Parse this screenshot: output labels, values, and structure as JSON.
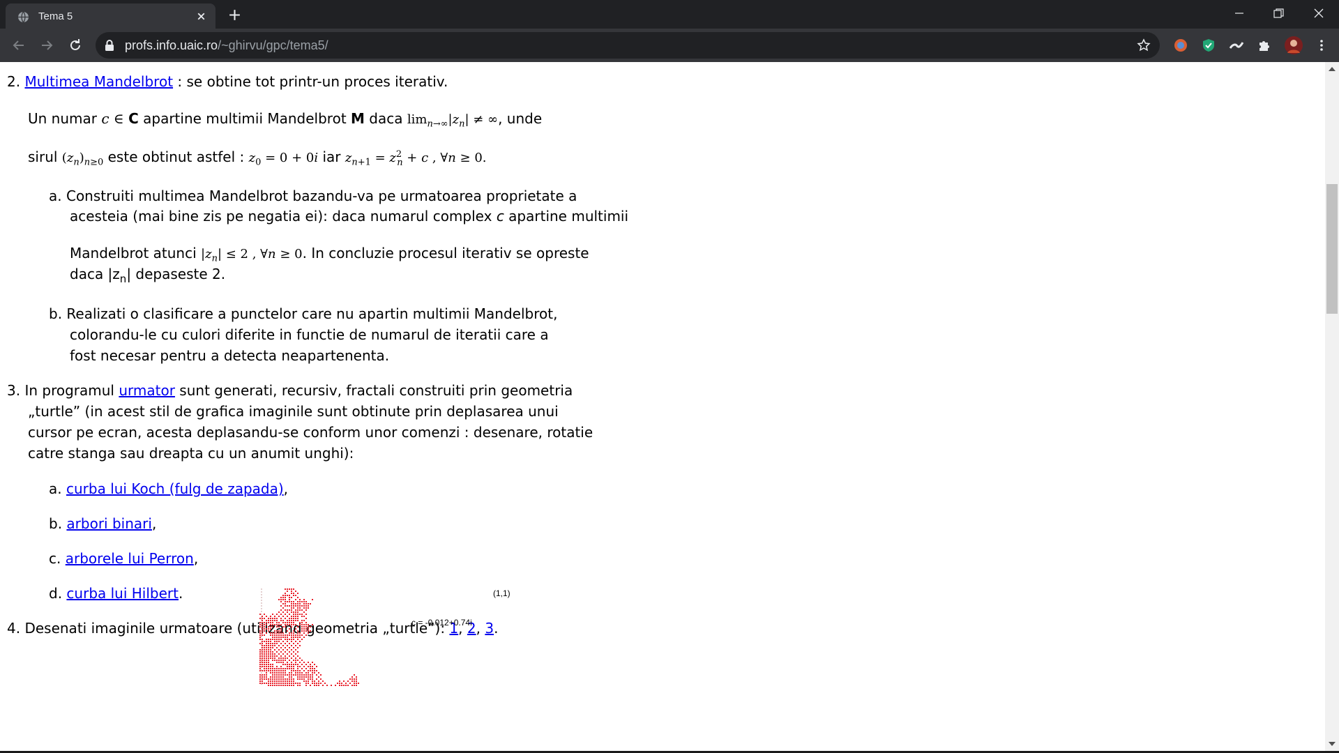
{
  "browser": {
    "tab_title": "Tema 5",
    "url_host": "profs.info.uaic.ro",
    "url_path": "/~ghirvu/gpc/tema5/"
  },
  "page": {
    "item2": {
      "number": "2.",
      "link": "Multimea Mandelbrot",
      "rest": " : se obtine tot printr-un proces iterativ.",
      "p1_a": "Un numar ",
      "p1_b": " apartine multimii Mandelbrot ",
      "p1_M": "M",
      "p1_c": " daca ",
      "p1_d": ", unde",
      "p2_a": "sirul ",
      "p2_b": " este obtinut astfel : ",
      "p2_c": " iar ",
      "sub_a": {
        "letter": "a.",
        "l1": "Construiti multimea Mandelbrot bazandu-va pe urmatoarea proprietate a",
        "l2a": "acesteia (mai bine zis pe negatia ei): daca numarul complex ",
        "l2c": "c",
        "l2b": " apartine multimii",
        "l3a": "Mandelbrot atunci ",
        "l3b": ". In concluzie procesul iterativ se opreste",
        "l4a": "daca |z",
        "l4sub": "n",
        "l4b": "| depaseste 2."
      },
      "sub_b": {
        "letter": "b.",
        "l1": "Realizati o clasificare a punctelor care nu apartin multimii Mandelbrot,",
        "l2": "colorandu-le cu culori diferite in functie de numarul de iteratii care a",
        "l3": "fost necesar pentru a detecta neapartenenta."
      }
    },
    "item3": {
      "number": "3.",
      "l1a": "In programul ",
      "l1link": "urmator",
      "l1b": " sunt generati, recursiv, fractali construiti prin geometria",
      "l2": "„turtle” (in acest stil de grafica imaginile sunt obtinute prin deplasarea unui",
      "l3": "cursor pe ecran, acesta deplasandu-se conform unor comenzi : desenare, rotatie",
      "l4": "catre stanga sau dreapta cu un anumit unghi):",
      "items": [
        {
          "letter": "a.",
          "link": "curba lui Koch (fulg de zapada)",
          "after": ","
        },
        {
          "letter": "b.",
          "link": "arbori binari",
          "after": ","
        },
        {
          "letter": "c.",
          "link": "arborele lui Perron",
          "after": ","
        },
        {
          "letter": "d.",
          "link": "curba lui Hilbert",
          "after": "."
        }
      ]
    },
    "item4": {
      "number": "4.",
      "text": "Desenati imaginile urmatoare (utilizand geometria „turtle”): ",
      "links": [
        "1",
        "2",
        "3"
      ],
      "sep": ", ",
      "end": "."
    },
    "figure": {
      "corner_label": "(1,1)",
      "c_label": "c = -0.012+0.74i",
      "fractal_color": "#e8202a"
    }
  }
}
